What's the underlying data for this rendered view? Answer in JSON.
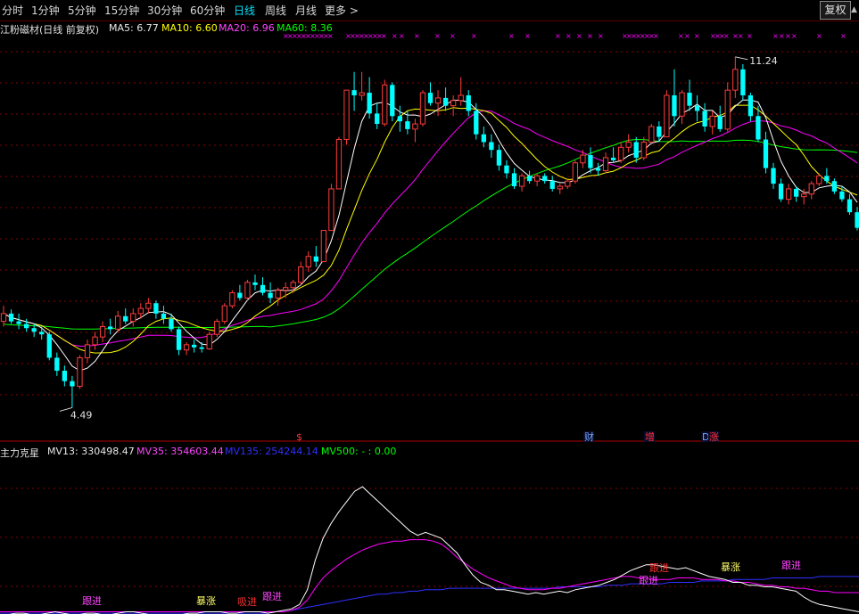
{
  "toolbar": {
    "periods": [
      "分时",
      "1分钟",
      "5分钟",
      "15分钟",
      "30分钟",
      "60分钟",
      "日线",
      "周线",
      "月线",
      "更多 >"
    ],
    "active": "日线",
    "fq_label": "复权"
  },
  "main_legend": {
    "title": "江粉磁材(日线 前复权)",
    "ma5": "MA5: 6.77",
    "ma10": "MA10: 6.60",
    "ma20": "MA20: 6.96",
    "ma60": "MA60: 8.36"
  },
  "sub_legend": {
    "title": "主力克星",
    "mv13": "MV13: 330498.47",
    "mv35": "MV35: 354603.44",
    "mv135": "MV135: 254244.14",
    "mv500": "MV500: - : 0.00"
  },
  "annotations": {
    "high": "11.24",
    "low": "4.49"
  },
  "event_markers": [
    {
      "label": "$",
      "color": "#ff3030"
    },
    {
      "label": "财",
      "color": "#6fa8ff"
    },
    {
      "label": "增",
      "color": "#ff3030"
    },
    {
      "label": "D",
      "color": "#6fa8ff"
    },
    {
      "label": "涨",
      "color": "#ff3030"
    }
  ],
  "signals": [
    "跟进",
    "暴涨",
    "吸进",
    "跟进",
    "跟进",
    "跟进",
    "暴涨",
    "跟进"
  ],
  "colors": {
    "up": "#ff3c3c",
    "down": "#00ffff",
    "ma5": "#ffffff",
    "ma10": "#ffff00",
    "ma20": "#ff00ff",
    "ma60": "#00ff00",
    "mv13": "#ffffff",
    "mv35": "#ff00ff",
    "mv135": "#3030ff",
    "grid": "#8b0000",
    "axis": "#b00000"
  },
  "chart_data": {
    "type": "candlestick",
    "low_price": 4.49,
    "high_price": 11.24,
    "ylim": [
      4.0,
      11.7
    ],
    "candles": [
      [
        6.15,
        6.45,
        6.05,
        6.3
      ],
      [
        6.3,
        6.38,
        6.1,
        6.15
      ],
      [
        6.15,
        6.3,
        6.0,
        6.1
      ],
      [
        6.1,
        6.2,
        5.95,
        6.02
      ],
      [
        6.02,
        6.1,
        5.85,
        5.95
      ],
      [
        5.95,
        6.05,
        5.8,
        5.9
      ],
      [
        5.9,
        5.95,
        5.4,
        5.45
      ],
      [
        5.45,
        5.55,
        5.1,
        5.2
      ],
      [
        5.2,
        5.3,
        4.9,
        5.0
      ],
      [
        5.0,
        5.1,
        4.49,
        4.9
      ],
      [
        4.9,
        5.5,
        4.85,
        5.45
      ],
      [
        5.45,
        5.8,
        5.35,
        5.7
      ],
      [
        5.7,
        5.95,
        5.6,
        5.85
      ],
      [
        5.85,
        6.15,
        5.75,
        6.05
      ],
      [
        6.05,
        6.2,
        5.9,
        6.0
      ],
      [
        6.0,
        6.35,
        5.95,
        6.25
      ],
      [
        6.25,
        6.4,
        6.1,
        6.15
      ],
      [
        6.15,
        6.4,
        6.05,
        6.3
      ],
      [
        6.3,
        6.5,
        6.2,
        6.4
      ],
      [
        6.4,
        6.6,
        6.3,
        6.5
      ],
      [
        6.5,
        6.55,
        6.2,
        6.3
      ],
      [
        6.3,
        6.45,
        6.1,
        6.2
      ],
      [
        6.2,
        6.3,
        5.95,
        6.0
      ],
      [
        6.0,
        6.05,
        5.5,
        5.6
      ],
      [
        5.6,
        5.75,
        5.5,
        5.7
      ],
      [
        5.7,
        5.8,
        5.55,
        5.65
      ],
      [
        5.65,
        5.75,
        5.55,
        5.62
      ],
      [
        5.62,
        5.95,
        5.6,
        5.9
      ],
      [
        5.9,
        6.2,
        5.85,
        6.15
      ],
      [
        6.15,
        6.5,
        6.1,
        6.45
      ],
      [
        6.45,
        6.75,
        6.4,
        6.7
      ],
      [
        6.7,
        6.85,
        6.55,
        6.6
      ],
      [
        6.6,
        6.95,
        6.55,
        6.9
      ],
      [
        6.9,
        7.05,
        6.75,
        6.85
      ],
      [
        6.85,
        7.0,
        6.65,
        6.7
      ],
      [
        6.7,
        6.9,
        6.5,
        6.6
      ],
      [
        6.6,
        6.8,
        6.45,
        6.75
      ],
      [
        6.75,
        6.9,
        6.6,
        6.8
      ],
      [
        6.8,
        6.95,
        6.7,
        6.9
      ],
      [
        6.9,
        7.3,
        6.85,
        7.2
      ],
      [
        7.2,
        7.5,
        7.1,
        7.4
      ],
      [
        7.4,
        7.6,
        7.2,
        7.3
      ],
      [
        7.3,
        7.9,
        7.3,
        7.9
      ],
      [
        7.9,
        8.8,
        7.9,
        8.7
      ],
      [
        8.7,
        9.7,
        8.7,
        9.65
      ],
      [
        9.65,
        10.6,
        9.55,
        10.6
      ],
      [
        10.6,
        10.95,
        10.2,
        10.5
      ],
      [
        10.5,
        10.95,
        10.4,
        10.55
      ],
      [
        10.55,
        10.85,
        10.05,
        10.15
      ],
      [
        10.15,
        10.35,
        9.85,
        9.95
      ],
      [
        9.95,
        10.8,
        9.9,
        10.7
      ],
      [
        10.7,
        10.75,
        10.0,
        10.1
      ],
      [
        10.1,
        10.3,
        9.8,
        10.0
      ],
      [
        10.0,
        10.2,
        9.75,
        9.85
      ],
      [
        9.85,
        10.05,
        9.6,
        9.95
      ],
      [
        9.95,
        10.6,
        9.9,
        10.55
      ],
      [
        10.55,
        10.75,
        10.3,
        10.35
      ],
      [
        10.35,
        10.6,
        10.1,
        10.45
      ],
      [
        10.45,
        10.65,
        10.2,
        10.3
      ],
      [
        10.3,
        10.5,
        10.1,
        10.4
      ],
      [
        10.4,
        10.85,
        10.3,
        10.5
      ],
      [
        10.5,
        10.6,
        10.1,
        10.2
      ],
      [
        10.2,
        10.35,
        9.65,
        9.75
      ],
      [
        9.75,
        9.9,
        9.5,
        9.6
      ],
      [
        9.6,
        9.75,
        9.3,
        9.45
      ],
      [
        9.45,
        9.55,
        9.05,
        9.15
      ],
      [
        9.15,
        9.25,
        8.9,
        9.0
      ],
      [
        9.0,
        9.1,
        8.7,
        8.75
      ],
      [
        8.75,
        9.0,
        8.65,
        8.95
      ],
      [
        8.95,
        9.05,
        8.8,
        8.85
      ],
      [
        8.85,
        9.0,
        8.75,
        8.95
      ],
      [
        8.95,
        9.0,
        8.8,
        8.85
      ],
      [
        8.85,
        8.95,
        8.65,
        8.7
      ],
      [
        8.7,
        8.8,
        8.6,
        8.75
      ],
      [
        8.75,
        8.9,
        8.7,
        8.85
      ],
      [
        8.85,
        9.25,
        8.8,
        9.2
      ],
      [
        9.2,
        9.45,
        9.1,
        9.35
      ],
      [
        9.35,
        9.5,
        9.0,
        9.1
      ],
      [
        9.1,
        9.2,
        8.95,
        9.05
      ],
      [
        9.05,
        9.4,
        9.0,
        9.3
      ],
      [
        9.3,
        9.5,
        9.2,
        9.25
      ],
      [
        9.25,
        9.6,
        9.2,
        9.5
      ],
      [
        9.5,
        9.75,
        9.4,
        9.6
      ],
      [
        9.6,
        9.7,
        9.2,
        9.3
      ],
      [
        9.3,
        9.7,
        9.25,
        9.6
      ],
      [
        9.6,
        9.95,
        9.55,
        9.9
      ],
      [
        9.9,
        10.0,
        9.6,
        9.7
      ],
      [
        9.7,
        10.6,
        9.7,
        10.5
      ],
      [
        10.5,
        11.0,
        9.9,
        10.1
      ],
      [
        10.1,
        10.6,
        9.95,
        10.55
      ],
      [
        10.55,
        10.8,
        10.2,
        10.3
      ],
      [
        10.3,
        10.5,
        10.0,
        10.2
      ],
      [
        10.2,
        10.35,
        9.8,
        9.9
      ],
      [
        9.9,
        10.2,
        9.75,
        10.1
      ],
      [
        10.1,
        10.3,
        9.8,
        9.85
      ],
      [
        9.85,
        10.75,
        9.8,
        10.6
      ],
      [
        10.6,
        11.24,
        10.45,
        11.0
      ],
      [
        11.0,
        11.1,
        10.4,
        10.5
      ],
      [
        10.5,
        10.55,
        10.0,
        10.1
      ],
      [
        10.1,
        10.3,
        9.6,
        9.65
      ],
      [
        9.65,
        9.8,
        9.0,
        9.1
      ],
      [
        9.1,
        9.2,
        8.7,
        8.8
      ],
      [
        8.8,
        8.9,
        8.45,
        8.5
      ],
      [
        8.5,
        8.8,
        8.4,
        8.7
      ],
      [
        8.7,
        8.75,
        8.45,
        8.55
      ],
      [
        8.55,
        8.7,
        8.4,
        8.6
      ],
      [
        8.6,
        8.85,
        8.5,
        8.8
      ],
      [
        8.8,
        9.0,
        8.75,
        8.95
      ],
      [
        8.95,
        9.1,
        8.8,
        8.85
      ],
      [
        8.85,
        8.9,
        8.6,
        8.65
      ],
      [
        8.65,
        8.75,
        8.45,
        8.5
      ],
      [
        8.5,
        8.6,
        8.2,
        8.25
      ],
      [
        8.25,
        8.35,
        7.9,
        7.95
      ]
    ],
    "volume_indicator": {
      "mv13": [
        0.08,
        0.08,
        0.09,
        0.09,
        0.08,
        0.08,
        0.09,
        0.1,
        0.09,
        0.08,
        0.08,
        0.09,
        0.09,
        0.08,
        0.08,
        0.09,
        0.1,
        0.1,
        0.09,
        0.08,
        0.07,
        0.07,
        0.08,
        0.08,
        0.09,
        0.09,
        0.1,
        0.1,
        0.1,
        0.09,
        0.09,
        0.1,
        0.1,
        0.1,
        0.09,
        0.1,
        0.11,
        0.12,
        0.15,
        0.25,
        0.45,
        0.6,
        0.7,
        0.78,
        0.85,
        0.92,
        0.95,
        0.9,
        0.85,
        0.8,
        0.75,
        0.7,
        0.65,
        0.62,
        0.64,
        0.62,
        0.6,
        0.55,
        0.5,
        0.42,
        0.35,
        0.3,
        0.28,
        0.25,
        0.25,
        0.24,
        0.23,
        0.22,
        0.23,
        0.22,
        0.23,
        0.24,
        0.23,
        0.25,
        0.26,
        0.27,
        0.28,
        0.3,
        0.32,
        0.35,
        0.38,
        0.4,
        0.42,
        0.42,
        0.41,
        0.4,
        0.39,
        0.4,
        0.38,
        0.36,
        0.34,
        0.33,
        0.32,
        0.3,
        0.3,
        0.28,
        0.28,
        0.27,
        0.27,
        0.26,
        0.25,
        0.24,
        0.2,
        0.17,
        0.15,
        0.14,
        0.13,
        0.12,
        0.11,
        0.1
      ],
      "mv35": [
        0.1,
        0.1,
        0.1,
        0.1,
        0.1,
        0.1,
        0.1,
        0.1,
        0.1,
        0.1,
        0.1,
        0.1,
        0.1,
        0.1,
        0.1,
        0.1,
        0.1,
        0.1,
        0.1,
        0.1,
        0.1,
        0.1,
        0.1,
        0.1,
        0.1,
        0.1,
        0.1,
        0.1,
        0.1,
        0.1,
        0.1,
        0.1,
        0.1,
        0.1,
        0.1,
        0.1,
        0.1,
        0.11,
        0.13,
        0.18,
        0.26,
        0.33,
        0.38,
        0.42,
        0.46,
        0.49,
        0.52,
        0.54,
        0.56,
        0.57,
        0.58,
        0.58,
        0.59,
        0.59,
        0.59,
        0.58,
        0.56,
        0.52,
        0.47,
        0.43,
        0.39,
        0.36,
        0.33,
        0.31,
        0.29,
        0.27,
        0.26,
        0.25,
        0.25,
        0.25,
        0.26,
        0.26,
        0.27,
        0.28,
        0.29,
        0.3,
        0.31,
        0.32,
        0.33,
        0.34,
        0.34,
        0.33,
        0.33,
        0.32,
        0.32,
        0.32,
        0.33,
        0.33,
        0.33,
        0.32,
        0.32,
        0.32,
        0.31,
        0.31,
        0.3,
        0.3,
        0.29,
        0.28,
        0.28,
        0.27,
        0.27,
        0.26,
        0.26,
        0.25,
        0.24,
        0.24,
        0.23,
        0.23,
        0.23,
        0.23
      ],
      "mv135": [
        0.09,
        0.09,
        0.09,
        0.09,
        0.09,
        0.09,
        0.09,
        0.09,
        0.09,
        0.09,
        0.09,
        0.09,
        0.09,
        0.09,
        0.09,
        0.09,
        0.09,
        0.09,
        0.09,
        0.09,
        0.09,
        0.09,
        0.09,
        0.09,
        0.09,
        0.09,
        0.09,
        0.09,
        0.09,
        0.09,
        0.09,
        0.09,
        0.09,
        0.09,
        0.09,
        0.1,
        0.1,
        0.11,
        0.12,
        0.13,
        0.14,
        0.15,
        0.16,
        0.17,
        0.18,
        0.19,
        0.2,
        0.21,
        0.22,
        0.22,
        0.23,
        0.23,
        0.24,
        0.24,
        0.25,
        0.25,
        0.25,
        0.26,
        0.26,
        0.26,
        0.26,
        0.26,
        0.26,
        0.26,
        0.26,
        0.26,
        0.26,
        0.26,
        0.26,
        0.26,
        0.26,
        0.27,
        0.27,
        0.27,
        0.27,
        0.27,
        0.27,
        0.28,
        0.28,
        0.28,
        0.29,
        0.29,
        0.29,
        0.29,
        0.29,
        0.3,
        0.3,
        0.3,
        0.3,
        0.31,
        0.31,
        0.31,
        0.31,
        0.32,
        0.32,
        0.32,
        0.32,
        0.32,
        0.33,
        0.33,
        0.33,
        0.33,
        0.33,
        0.33,
        0.34,
        0.34,
        0.34,
        0.34,
        0.34,
        0.34
      ]
    }
  }
}
